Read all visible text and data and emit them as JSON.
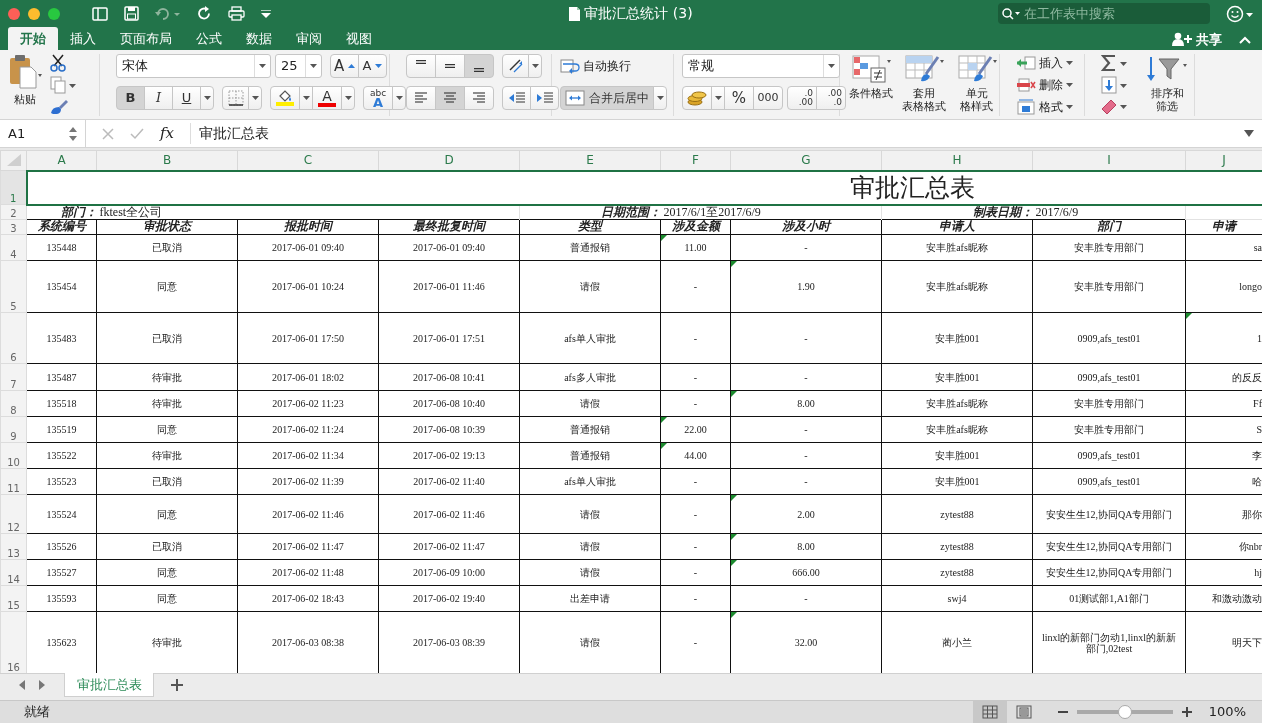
{
  "window": {
    "title": "审批汇总统计 (3)",
    "search": {
      "placeholder": "在工作表中搜索"
    }
  },
  "ribbon_tabs": [
    {
      "label": "开始",
      "selected": true
    },
    {
      "label": "插入",
      "selected": false
    },
    {
      "label": "页面布局",
      "selected": false
    },
    {
      "label": "公式",
      "selected": false
    },
    {
      "label": "数据",
      "selected": false
    },
    {
      "label": "审阅",
      "selected": false
    },
    {
      "label": "视图",
      "selected": false
    }
  ],
  "share": "共享",
  "ribbon": {
    "paste": "粘贴",
    "font": "宋体",
    "font_size": "25",
    "grow": "A",
    "shrink": "A",
    "styles": [
      {
        "kind": "bold",
        "label": "B",
        "pressed": true
      },
      {
        "kind": "italic",
        "label": "I",
        "pressed": false
      },
      {
        "kind": "underline",
        "label": "U",
        "pressed": false
      }
    ],
    "fill": {
      "color": "#ffee00"
    },
    "font_color": {
      "label": "A",
      "color": "#ee0000"
    },
    "phonetic": "abc",
    "phonetic_letter": "A",
    "vertical_align": [
      {
        "kind": "top",
        "selected": false
      },
      {
        "kind": "middle",
        "selected": false
      },
      {
        "kind": "bottom",
        "selected": true
      }
    ],
    "horizontal_align": [
      {
        "kind": "left",
        "selected": false
      },
      {
        "kind": "center",
        "selected": true
      },
      {
        "kind": "right",
        "selected": false
      }
    ],
    "wrap": {
      "label": "自动换行",
      "pressed": false
    },
    "merge": {
      "label": "合并后居中",
      "pressed": true
    },
    "number_format": "常规",
    "percent": "%",
    "thousands": "000",
    "add_decimal": [
      ".0",
      ".00"
    ],
    "remove_decimal": [
      ".00",
      ".0"
    ],
    "conditional": [
      "条件格式"
    ],
    "table_format": [
      "套用",
      "表格格式"
    ],
    "cell_styles": [
      "单元",
      "格样式"
    ],
    "insert": "插入",
    "delete": "删除",
    "format": "格式",
    "sort_filter": [
      "排序和",
      "筛选"
    ]
  },
  "formula_bar": {
    "name_box": "A1",
    "fx": "fx",
    "formula": "审批汇总表"
  },
  "sheet": {
    "columns": [
      "A",
      "B",
      "C",
      "D",
      "E",
      "F",
      "G",
      "H",
      "I",
      "J"
    ],
    "title_row": {
      "number": "1",
      "selected": true,
      "title": "审批汇总表"
    },
    "info_row": {
      "number": "2",
      "selected": false,
      "department_label": "部门：",
      "department": "fktest全公司",
      "date_range_label": "日期范围：",
      "date_range": "2017/6/1至2017/6/9",
      "made_date_label": "制表日期：",
      "made_date": "2017/6/9"
    },
    "header_row": {
      "number": "3",
      "selected": false,
      "cells": [
        "系统编号",
        "审批状态",
        "报批时间",
        "最终批复时间",
        "类型",
        "涉及金额",
        "涉及小时",
        "申请人",
        "部门",
        "申请"
      ]
    },
    "rows": [
      {
        "number": "4",
        "selected": false,
        "amount_flag": true,
        "hours_flag": false,
        "column_j_flag": false,
        "cells": [
          "135448",
          "已取消",
          "2017-06-01 09:40",
          "2017-06-01 09:40",
          "普通报销",
          "11.00",
          "-",
          "安丰胜afs昵称",
          "安丰胜专用部门",
          "sa"
        ]
      },
      {
        "number": "5",
        "selected": false,
        "amount_flag": false,
        "hours_flag": true,
        "column_j_flag": false,
        "cells": [
          "135454",
          "同意",
          "2017-06-01 10:24",
          "2017-06-01 11:46",
          "请假",
          "-",
          "1.90",
          "安丰胜afs昵称",
          "安丰胜专用部门",
          "longo"
        ]
      },
      {
        "number": "6",
        "selected": false,
        "amount_flag": false,
        "hours_flag": false,
        "column_j_flag": true,
        "cells": [
          "135483",
          "已取消",
          "2017-06-01 17:50",
          "2017-06-01 17:51",
          "afs单人审批",
          "-",
          "-",
          "安丰胜001",
          "0909,afs_test01",
          "1"
        ]
      },
      {
        "number": "7",
        "selected": false,
        "amount_flag": false,
        "hours_flag": false,
        "column_j_flag": false,
        "cells": [
          "135487",
          "待审批",
          "2017-06-01 18:02",
          "2017-06-08 10:41",
          "afs多人审批",
          "-",
          "-",
          "安丰胜001",
          "0909,afs_test01",
          "的反反"
        ]
      },
      {
        "number": "8",
        "selected": false,
        "amount_flag": false,
        "hours_flag": true,
        "column_j_flag": false,
        "cells": [
          "135518",
          "待审批",
          "2017-06-02 11:23",
          "2017-06-08 10:40",
          "请假",
          "-",
          "8.00",
          "安丰胜afs昵称",
          "安丰胜专用部门",
          "Ff"
        ]
      },
      {
        "number": "9",
        "selected": false,
        "amount_flag": true,
        "hours_flag": false,
        "column_j_flag": false,
        "cells": [
          "135519",
          "同意",
          "2017-06-02 11:24",
          "2017-06-08 10:39",
          "普通报销",
          "22.00",
          "-",
          "安丰胜afs昵称",
          "安丰胜专用部门",
          "S"
        ]
      },
      {
        "number": "10",
        "selected": false,
        "amount_flag": true,
        "hours_flag": false,
        "column_j_flag": false,
        "cells": [
          "135522",
          "待审批",
          "2017-06-02 11:34",
          "2017-06-02 19:13",
          "普通报销",
          "44.00",
          "-",
          "安丰胜001",
          "0909,afs_test01",
          "李"
        ]
      },
      {
        "number": "11",
        "selected": false,
        "amount_flag": false,
        "hours_flag": false,
        "column_j_flag": false,
        "cells": [
          "135523",
          "已取消",
          "2017-06-02 11:39",
          "2017-06-02 11:40",
          "afs单人审批",
          "-",
          "-",
          "安丰胜001",
          "0909,afs_test01",
          "哈"
        ]
      },
      {
        "number": "12",
        "selected": false,
        "amount_flag": false,
        "hours_flag": true,
        "column_j_flag": false,
        "cells": [
          "135524",
          "同意",
          "2017-06-02 11:46",
          "2017-06-02 11:46",
          "请假",
          "-",
          "2.00",
          "zytest88",
          "安安生生12,协同QA专用部门",
          "那你"
        ]
      },
      {
        "number": "13",
        "selected": false,
        "amount_flag": false,
        "hours_flag": true,
        "column_j_flag": false,
        "cells": [
          "135526",
          "已取消",
          "2017-06-02 11:47",
          "2017-06-02 11:47",
          "请假",
          "-",
          "8.00",
          "zytest88",
          "安安生生12,协同QA专用部门",
          "你nbr"
        ]
      },
      {
        "number": "14",
        "selected": false,
        "amount_flag": false,
        "hours_flag": true,
        "column_j_flag": false,
        "cells": [
          "135527",
          "同意",
          "2017-06-02 11:48",
          "2017-06-09 10:00",
          "请假",
          "-",
          "666.00",
          "zytest88",
          "安安生生12,协同QA专用部门",
          "hj"
        ]
      },
      {
        "number": "15",
        "selected": false,
        "amount_flag": false,
        "hours_flag": false,
        "column_j_flag": false,
        "cells": [
          "135593",
          "同意",
          "2017-06-02 18:43",
          "2017-06-02 19:40",
          "出差申请",
          "-",
          "-",
          "swj4",
          "01测试部1,A1部门",
          "和激动激动"
        ]
      },
      {
        "number": "16",
        "selected": false,
        "amount_flag": false,
        "hours_flag": true,
        "column_j_flag": false,
        "cells": [
          "135623",
          "待审批",
          "2017-06-03 08:38",
          "2017-06-03 08:39",
          "请假",
          "-",
          "32.00",
          "蔺小兰",
          "linxl的新部门勿动1,linxl的新新部门,02test",
          "明天下"
        ]
      }
    ]
  },
  "sheet_tabs": [
    {
      "label": "审批汇总表",
      "selected": true
    }
  ],
  "status_bar": {
    "status": "就绪",
    "zoom": {
      "level": 0.5
    },
    "zoom_label": "100%"
  }
}
